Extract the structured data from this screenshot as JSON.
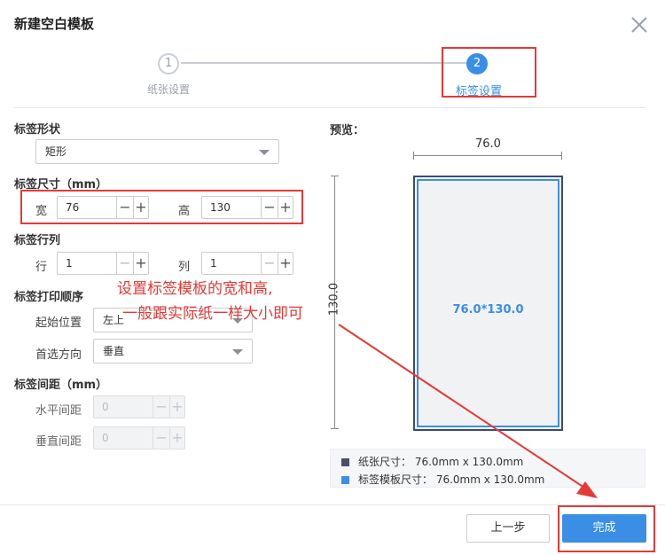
{
  "dialog": {
    "title": "新建空白模板"
  },
  "stepper": {
    "steps": [
      {
        "number": "1",
        "label": "纸张设置"
      },
      {
        "number": "2",
        "label": "标签设置"
      }
    ]
  },
  "form": {
    "shape": {
      "heading": "标签形状",
      "selected": "矩形"
    },
    "size": {
      "heading": "标签尺寸（mm）",
      "width_label": "宽",
      "width_value": "76",
      "height_label": "高",
      "height_value": "130"
    },
    "grid": {
      "heading": "标签行列",
      "rows_label": "行",
      "rows_value": "1",
      "cols_label": "列",
      "cols_value": "1"
    },
    "print_order": {
      "heading": "标签打印顺序",
      "start_label": "起始位置",
      "start_value": "左上",
      "direction_label": "首选方向",
      "direction_value": "垂直"
    },
    "spacing": {
      "heading": "标签间距（mm）",
      "h_label": "水平间距",
      "h_value": "0",
      "v_label": "垂直间距",
      "v_value": "0"
    },
    "stepper_minus": "−",
    "stepper_plus": "+"
  },
  "annotation": {
    "line1": "设置标签模板的宽和高,",
    "line2": "一般跟实际纸一样大小即可"
  },
  "preview": {
    "heading": "预览：",
    "width_dim": "76.0",
    "height_dim": "130.0",
    "template_text": "76.0*130.0",
    "legend": [
      {
        "text": "纸张尺寸：  76.0mm x 130.0mm",
        "color": "#4a4e69"
      },
      {
        "text": "标签模板尺寸：  76.0mm x 130.0mm",
        "color": "#3a8ee6"
      }
    ]
  },
  "footer": {
    "prev_label": "上一步",
    "done_label": "完成"
  },
  "colors": {
    "accent": "#3a8ee6",
    "highlight": "#e53935"
  }
}
